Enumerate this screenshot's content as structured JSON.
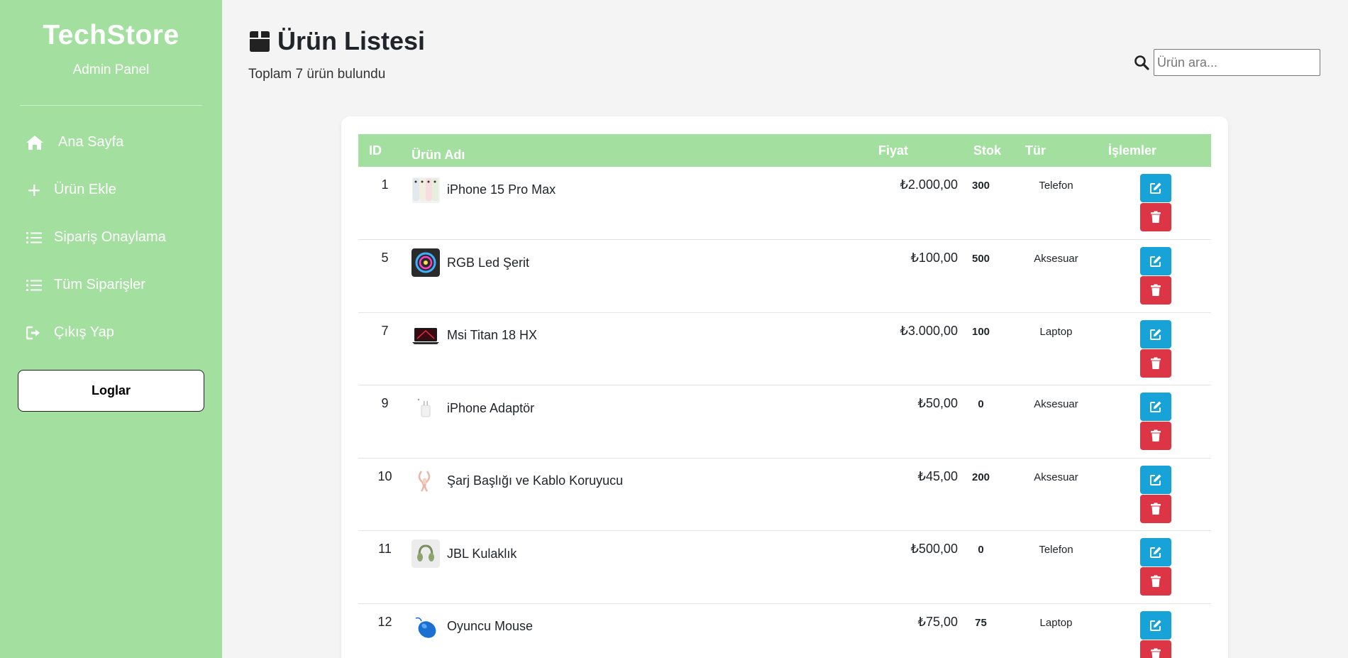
{
  "sidebar": {
    "brand": "TechStore",
    "subtitle": "Admin Panel",
    "nav": [
      {
        "label": "Ana Sayfa",
        "icon": "home-icon"
      },
      {
        "label": "Ürün Ekle",
        "icon": "plus-icon"
      },
      {
        "label": "Sipariş Onaylama",
        "icon": "list-icon"
      },
      {
        "label": "Tüm Siparişler",
        "icon": "list-icon"
      },
      {
        "label": "Çıkış Yap",
        "icon": "sign-out-icon"
      }
    ],
    "logs_button": "Loglar"
  },
  "header": {
    "title": "Ürün Listesi",
    "subtitle": "Toplam 7 ürün bulundu",
    "search_placeholder": "Ürün ara..."
  },
  "table": {
    "columns": {
      "id": "ID",
      "name": "Ürün Adı",
      "price": "Fiyat",
      "stock": "Stok",
      "type": "Tür",
      "actions": "İşlemler"
    },
    "rows": [
      {
        "id": "1",
        "name": "iPhone 15 Pro Max",
        "price": "₺2.000,00",
        "stock": "300",
        "type": "Telefon",
        "thumb": "iphone-thumbnail"
      },
      {
        "id": "5",
        "name": "RGB Led Şerit",
        "price": "₺100,00",
        "stock": "500",
        "type": "Aksesuar",
        "thumb": "rgb-led-thumbnail"
      },
      {
        "id": "7",
        "name": "Msi Titan 18 HX",
        "price": "₺3.000,00",
        "stock": "100",
        "type": "Laptop",
        "thumb": "laptop-thumbnail"
      },
      {
        "id": "9",
        "name": "iPhone Adaptör",
        "price": "₺50,00",
        "stock": "0",
        "type": "Aksesuar",
        "thumb": "adapter-thumbnail"
      },
      {
        "id": "10",
        "name": "Şarj Başlığı ve Kablo Koruyucu",
        "price": "₺45,00",
        "stock": "200",
        "type": "Aksesuar",
        "thumb": "cable-thumbnail"
      },
      {
        "id": "11",
        "name": "JBL Kulaklık",
        "price": "₺500,00",
        "stock": "0",
        "type": "Telefon",
        "thumb": "headphones-thumbnail"
      },
      {
        "id": "12",
        "name": "Oyuncu Mouse",
        "price": "₺75,00",
        "stock": "75",
        "type": "Laptop",
        "thumb": "mouse-thumbnail"
      }
    ]
  },
  "colors": {
    "sidebar": "#a3e09f",
    "edit": "#17a2d8",
    "delete": "#dc3545"
  }
}
